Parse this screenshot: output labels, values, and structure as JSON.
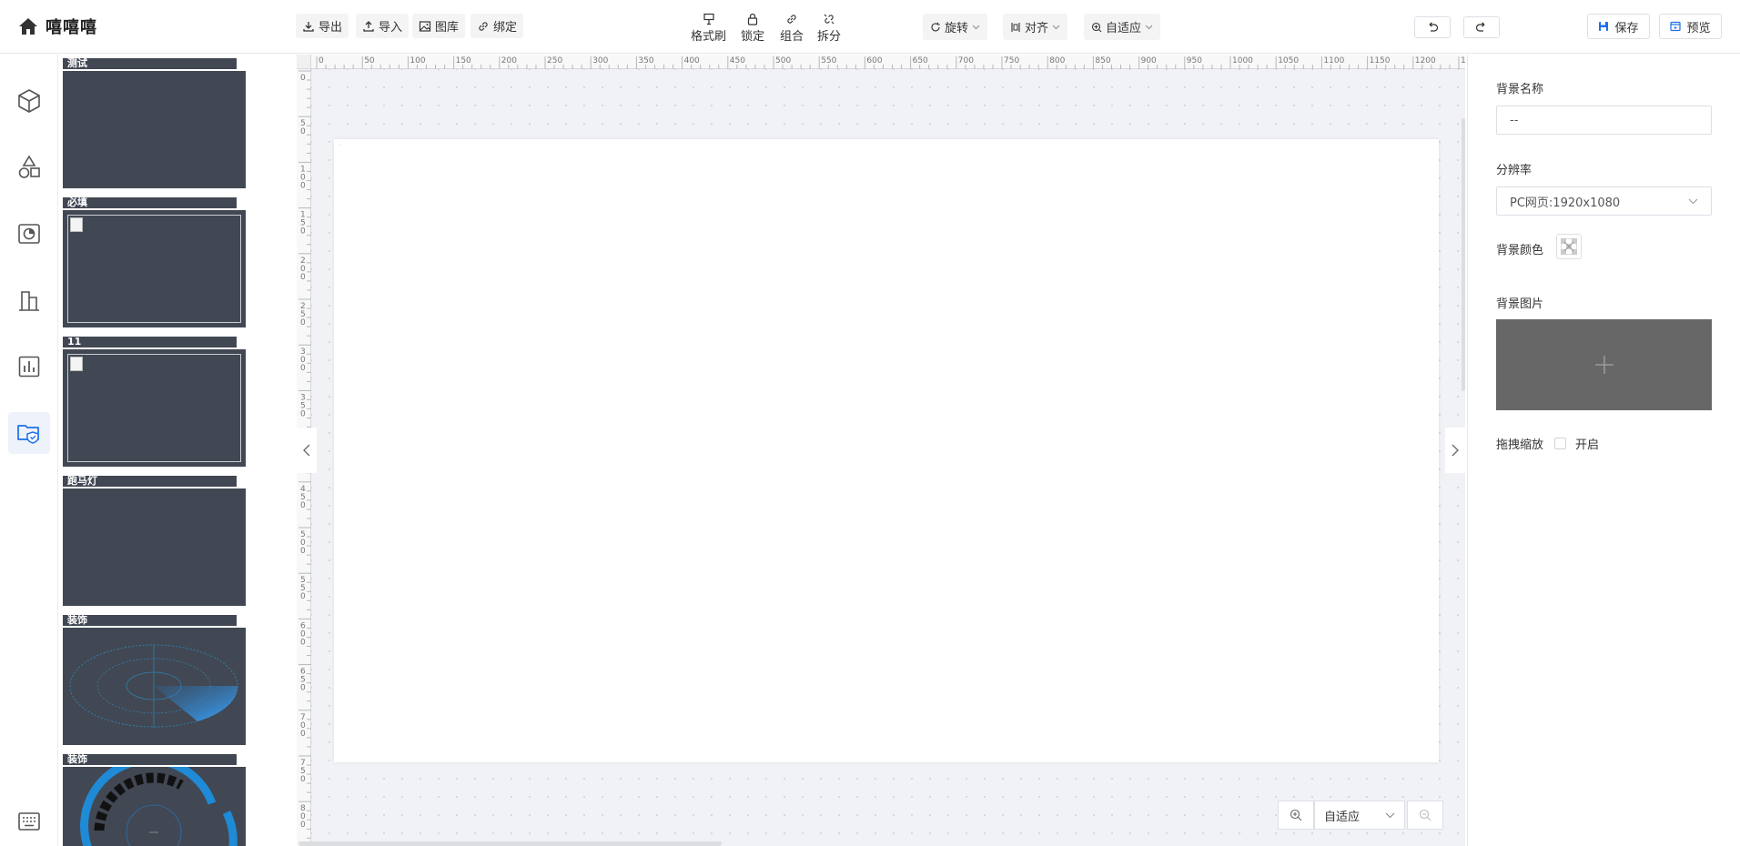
{
  "app": {
    "title": "嘻嘻嘻"
  },
  "toolbar": {
    "left": [
      {
        "label": "导出",
        "icon": "export-icon"
      },
      {
        "label": "导入",
        "icon": "import-icon"
      },
      {
        "label": "图库",
        "icon": "image-icon"
      },
      {
        "label": "绑定",
        "icon": "link-icon"
      }
    ],
    "middle": [
      {
        "label": "格式刷",
        "icon": "format-brush-icon"
      },
      {
        "label": "锁定",
        "icon": "lock-icon"
      },
      {
        "label": "组合",
        "icon": "group-icon"
      },
      {
        "label": "拆分",
        "icon": "split-icon"
      }
    ],
    "rotate": "旋转",
    "align": "对齐",
    "fit": "自适应",
    "save": "保存",
    "preview": "预览"
  },
  "rail": [
    {
      "icon": "cube-icon"
    },
    {
      "icon": "shapes-icon"
    },
    {
      "icon": "chart-card-icon"
    },
    {
      "icon": "building-icon"
    },
    {
      "icon": "bar-chart-icon"
    },
    {
      "icon": "folder-shield-icon",
      "active": true
    },
    {
      "icon": "keyboard-icon"
    }
  ],
  "layers": [
    {
      "title": "测试",
      "type": "blank"
    },
    {
      "title": "必填",
      "type": "image"
    },
    {
      "title": "11",
      "type": "image"
    },
    {
      "title": "跑马灯",
      "type": "blank"
    },
    {
      "title": "装饰",
      "type": "radar"
    },
    {
      "title": "装饰",
      "type": "gauge"
    }
  ],
  "ruler": {
    "h": [
      "0",
      "50",
      "100",
      "150",
      "200",
      "250",
      "300",
      "350",
      "400",
      "450",
      "500",
      "550",
      "600",
      "650",
      "700",
      "750",
      "800",
      "850",
      "900",
      "950",
      "1000",
      "1050",
      "1100",
      "1150",
      "1200",
      "12"
    ],
    "v": [
      "0",
      "50",
      "100",
      "150",
      "200",
      "250",
      "300",
      "350",
      "400",
      "450",
      "500",
      "550",
      "600",
      "650",
      "700",
      "750",
      "800"
    ]
  },
  "zoom": {
    "value": "自适应"
  },
  "panel": {
    "bg_name_label": "背景名称",
    "bg_name_value": "--",
    "resolution_label": "分辨率",
    "resolution_value": "PC网页:1920x1080",
    "bg_color_label": "背景颜色",
    "bg_image_label": "背景图片",
    "drag_zoom_label": "拖拽缩放",
    "drag_zoom_option": "开启"
  },
  "colors": {
    "accent": "#1e6fe8",
    "layer_bg": "#414853",
    "upload_bg": "#676767"
  }
}
